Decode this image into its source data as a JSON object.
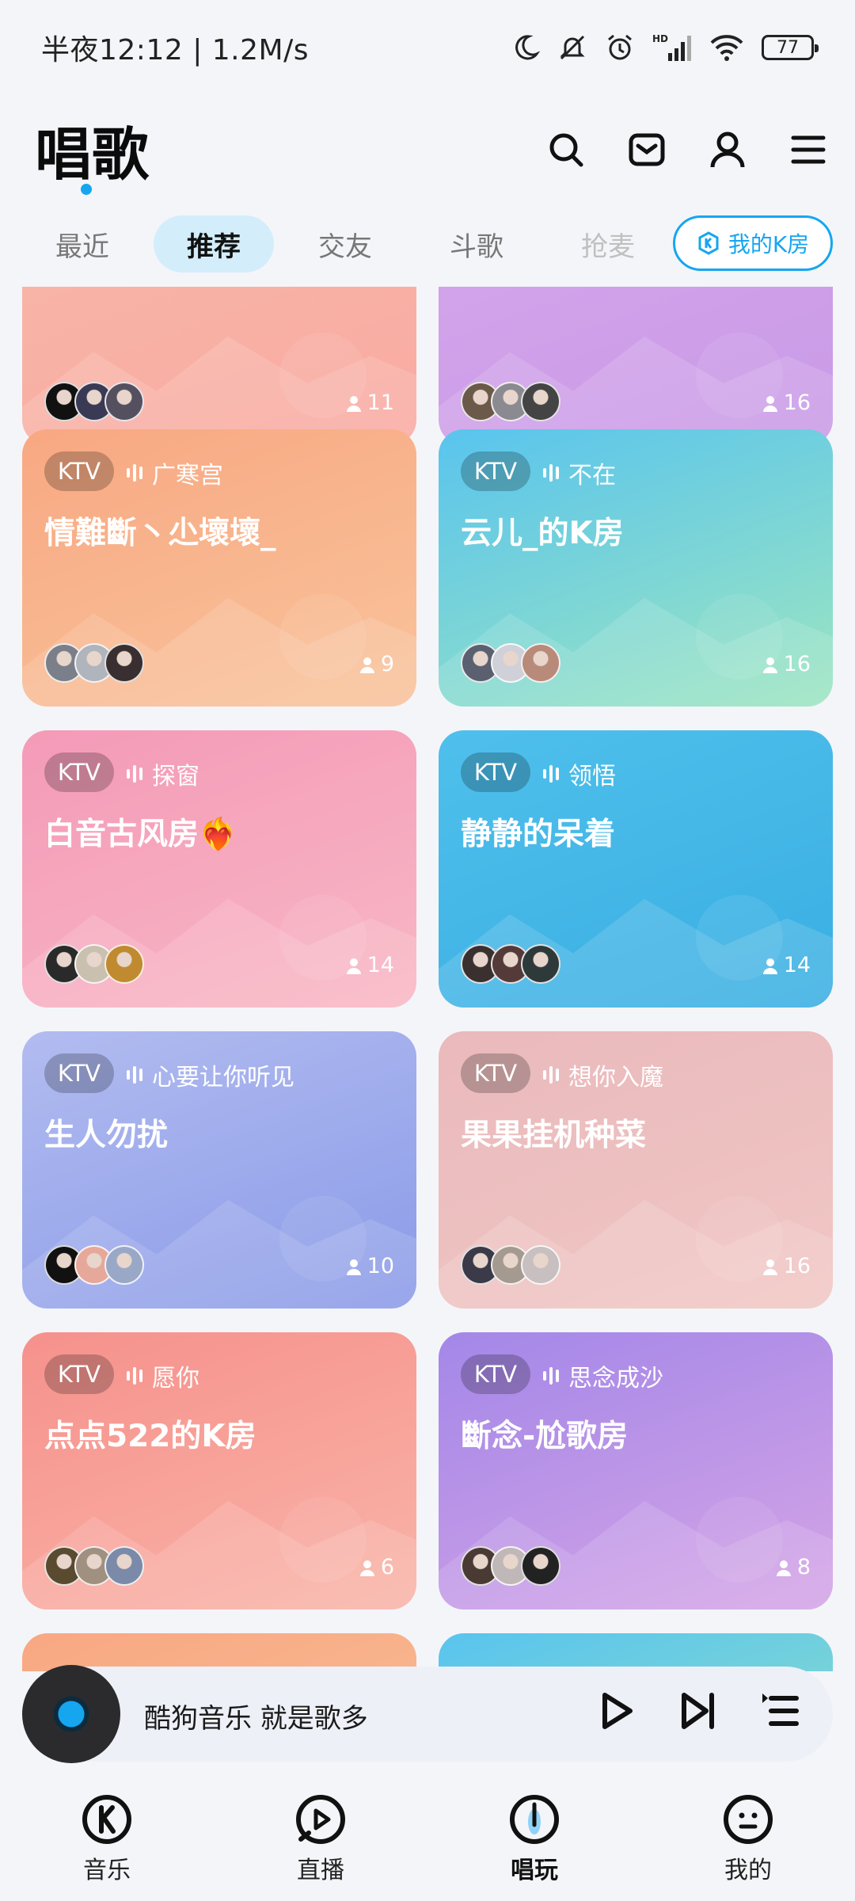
{
  "status_bar": {
    "time_speed": "半夜12:12 | 1.2M/s",
    "battery": "77",
    "icons": [
      "moon-icon",
      "bell-off-icon",
      "alarm-icon",
      "hd-signal-icon",
      "wifi-icon",
      "battery-icon"
    ]
  },
  "header": {
    "title": "唱歌",
    "icons": [
      "search-icon",
      "mail-icon",
      "user-icon",
      "menu-icon"
    ]
  },
  "tabs": [
    {
      "label": "最近",
      "active": false
    },
    {
      "label": "推荐",
      "active": true
    },
    {
      "label": "交友",
      "active": false
    },
    {
      "label": "斗歌",
      "active": false
    },
    {
      "label": "抢麦",
      "active": false
    }
  ],
  "my_k_room": {
    "label": "我的K房",
    "icon": "k-icon"
  },
  "cards": [
    {
      "badge": "",
      "host": "",
      "name": "",
      "count": "11",
      "colors": [
        "#f8b8a8",
        "#f9aaa2"
      ],
      "avatars": [
        "#111111",
        "#3a3a55",
        "#555060"
      ]
    },
    {
      "badge": "",
      "host": "",
      "name": "",
      "count": "16",
      "colors": [
        "#d6a6ec",
        "#c99ae6"
      ],
      "avatars": [
        "#6b5a4a",
        "#8a8a90",
        "#444444"
      ]
    },
    {
      "badge": "KTV",
      "host": "广寒宫",
      "name": "情難斷丶尐壞壞_",
      "count": "9",
      "colors": [
        "#f8a882",
        "#f9c39b"
      ],
      "avatars": [
        "#7a7f8a",
        "#b0b4bc",
        "#3a2f30"
      ]
    },
    {
      "badge": "KTV",
      "host": "不在",
      "name": "云儿_的K房",
      "count": "16",
      "colors": [
        "#59c4ee",
        "#9ce5c0"
      ],
      "avatars": [
        "#5a6070",
        "#d0d0d8",
        "#b88a7a"
      ]
    },
    {
      "badge": "KTV",
      "host": "探窗",
      "name": "白音古风房❤️‍🔥",
      "count": "14",
      "colors": [
        "#f49ab8",
        "#f8b7c4"
      ],
      "avatars": [
        "#2a2a2a",
        "#c9c0b0",
        "#c08a30"
      ]
    },
    {
      "badge": "KTV",
      "host": "领悟",
      "name": "静静的呆着",
      "count": "14",
      "colors": [
        "#4fc0ec",
        "#39aee2"
      ],
      "avatars": [
        "#3a3030",
        "#553a3a",
        "#2e3a3a"
      ]
    },
    {
      "badge": "KTV",
      "host": "心要让你听见",
      "name": "生人勿扰",
      "count": "10",
      "colors": [
        "#b2bcf0",
        "#8a9ae8"
      ],
      "avatars": [
        "#111111",
        "#e6a89a",
        "#9aa8c8"
      ]
    },
    {
      "badge": "KTV",
      "host": "想你入魔",
      "name": "果果挂机种菜",
      "count": "16",
      "colors": [
        "#eab9bc",
        "#f0c7c4"
      ],
      "avatars": [
        "#3a3a48",
        "#a59a90",
        "#c8c0c0"
      ]
    },
    {
      "badge": "KTV",
      "host": "愿你",
      "name": "点点522的K房",
      "count": "6",
      "colors": [
        "#f6918c",
        "#f9b4a8"
      ],
      "avatars": [
        "#5a4a30",
        "#a09080",
        "#7a8aa8"
      ]
    },
    {
      "badge": "KTV",
      "host": "思念成沙",
      "name": "斷念-尬歌房",
      "count": "8",
      "colors": [
        "#a387e8",
        "#d5a4e6"
      ],
      "avatars": [
        "#4a3a34",
        "#c0b8b8",
        "#222222"
      ]
    },
    {
      "badge": "",
      "host": "",
      "name": "",
      "count": "",
      "colors": [
        "#f8a882",
        "#f9c39b"
      ],
      "avatars": []
    },
    {
      "badge": "",
      "host": "",
      "name": "",
      "count": "",
      "colors": [
        "#59c4ee",
        "#9ce5c0"
      ],
      "avatars": []
    }
  ],
  "player": {
    "text": "酷狗音乐  就是歌多"
  },
  "bottom_nav": [
    {
      "label": "音乐",
      "icon": "music-k-icon",
      "active": false
    },
    {
      "label": "直播",
      "icon": "live-icon",
      "active": false
    },
    {
      "label": "唱玩",
      "icon": "sing-icon",
      "active": true
    },
    {
      "label": "我的",
      "icon": "me-icon",
      "active": false
    }
  ]
}
